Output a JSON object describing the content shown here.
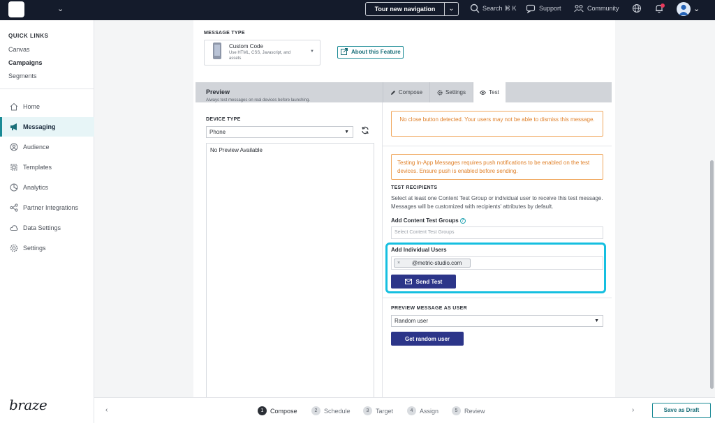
{
  "topbar": {
    "tour_label": "Tour new navigation",
    "search_label": "Search ⌘ K",
    "support_label": "Support",
    "community_label": "Community"
  },
  "sidebar": {
    "quick_links_title": "QUICK LINKS",
    "quick_links": [
      "Canvas",
      "Campaigns",
      "Segments"
    ],
    "nav_items": [
      {
        "label": "Home",
        "icon": "home-icon"
      },
      {
        "label": "Messaging",
        "icon": "megaphone-icon"
      },
      {
        "label": "Audience",
        "icon": "audience-icon"
      },
      {
        "label": "Templates",
        "icon": "templates-icon"
      },
      {
        "label": "Analytics",
        "icon": "analytics-icon"
      },
      {
        "label": "Partner Integrations",
        "icon": "integrations-icon"
      },
      {
        "label": "Data Settings",
        "icon": "cloud-icon"
      },
      {
        "label": "Settings",
        "icon": "gear-icon"
      }
    ],
    "brand": "braze"
  },
  "message_type": {
    "label": "MESSAGE TYPE",
    "selected_title": "Custom Code",
    "selected_sub": "Use HTML, CSS, Javascript, and assets",
    "about_button": "About this Feature"
  },
  "preview": {
    "title": "Preview",
    "subtitle": "Always test messages on real devices before launching.",
    "device_type_label": "DEVICE TYPE",
    "device_type_value": "Phone",
    "no_preview": "No Preview Available"
  },
  "tabs": [
    {
      "label": "Compose",
      "icon": "pencil-icon"
    },
    {
      "label": "Settings",
      "icon": "gear-icon"
    },
    {
      "label": "Test",
      "icon": "eye-icon"
    }
  ],
  "test_panel": {
    "warning_close": "No close button detected. Your users may not be able to dismiss this message.",
    "warning_push": "Testing In-App Messages requires push notifications to be enabled on the test devices. Ensure push is enabled before sending.",
    "recipients_title": "TEST RECIPIENTS",
    "recipients_desc": "Select at least one Content Test Group or individual user to receive this test message. Messages will be customized with recipients' attributes by default.",
    "content_groups_label": "Add Content Test Groups",
    "content_groups_placeholder": "Select Content Test Groups",
    "individual_users_label": "Add Individual Users",
    "chip_remove": "×",
    "chip_email": "@metric-studio.com",
    "send_test_label": "Send Test",
    "preview_as_user_title": "PREVIEW MESSAGE AS USER",
    "preview_as_user_value": "Random user",
    "get_random_label": "Get random user"
  },
  "footer": {
    "steps": [
      {
        "num": "1",
        "label": "Compose"
      },
      {
        "num": "2",
        "label": "Schedule"
      },
      {
        "num": "3",
        "label": "Target"
      },
      {
        "num": "4",
        "label": "Assign"
      },
      {
        "num": "5",
        "label": "Review"
      }
    ],
    "save_draft": "Save as Draft"
  },
  "colors": {
    "topbar_bg": "#141b2b",
    "accent_teal": "#1a8a95",
    "primary_button": "#2c3589",
    "warning_orange": "#e0822c",
    "highlight_cyan": "#15bfe0"
  }
}
